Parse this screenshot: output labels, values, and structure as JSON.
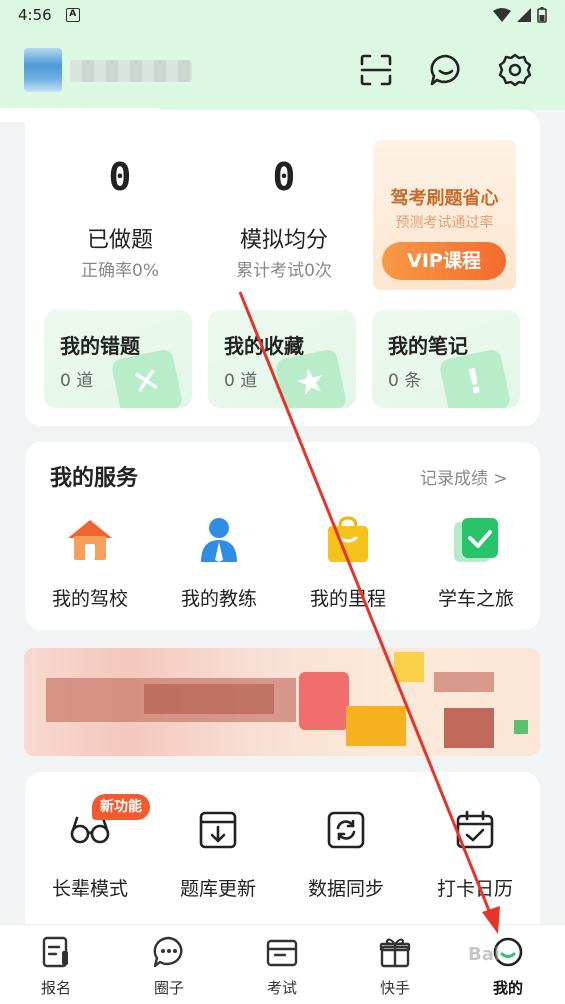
{
  "status_bar": {
    "time": "4:56"
  },
  "stats": [
    {
      "value": "0",
      "label": "已做题",
      "sub": "正确率0%"
    },
    {
      "value": "0",
      "label": "模拟均分",
      "sub": "累计考试0次"
    }
  ],
  "vip": {
    "title": "驾考刷题省心",
    "subtitle": "预测考试通过率",
    "button": "VIP课程"
  },
  "tiles": [
    {
      "title": "我的错题",
      "count": "0 道",
      "icon": "✕"
    },
    {
      "title": "我的收藏",
      "count": "0 道",
      "icon": "★"
    },
    {
      "title": "我的笔记",
      "count": "0 条",
      "icon": "!"
    }
  ],
  "services": {
    "title": "我的服务",
    "link": "记录成绩 >",
    "items": [
      {
        "label": "我的驾校",
        "icon": "house-icon"
      },
      {
        "label": "我的教练",
        "icon": "coach-icon"
      },
      {
        "label": "我的里程",
        "icon": "bag-icon"
      },
      {
        "label": "学车之旅",
        "icon": "check-icon"
      }
    ]
  },
  "tools": {
    "badge": "新功能",
    "items": [
      {
        "label": "长辈模式",
        "icon": "glasses-icon"
      },
      {
        "label": "题库更新",
        "icon": "download-icon"
      },
      {
        "label": "数据同步",
        "icon": "sync-icon"
      },
      {
        "label": "打卡日历",
        "icon": "calendar-icon"
      }
    ]
  },
  "tabs": [
    {
      "label": "报名",
      "icon": "document-icon"
    },
    {
      "label": "圈子",
      "icon": "chat-icon"
    },
    {
      "label": "考试",
      "icon": "folder-icon"
    },
    {
      "label": "快手",
      "icon": "gift-icon"
    },
    {
      "label": "我的",
      "icon": "profile-icon"
    }
  ],
  "watermark": "Bai",
  "colors": {
    "accent": "#29c46a",
    "header_bg": "#dcf7e2",
    "vip_orange": "#f46b2d",
    "arrow": "#e5342a"
  }
}
